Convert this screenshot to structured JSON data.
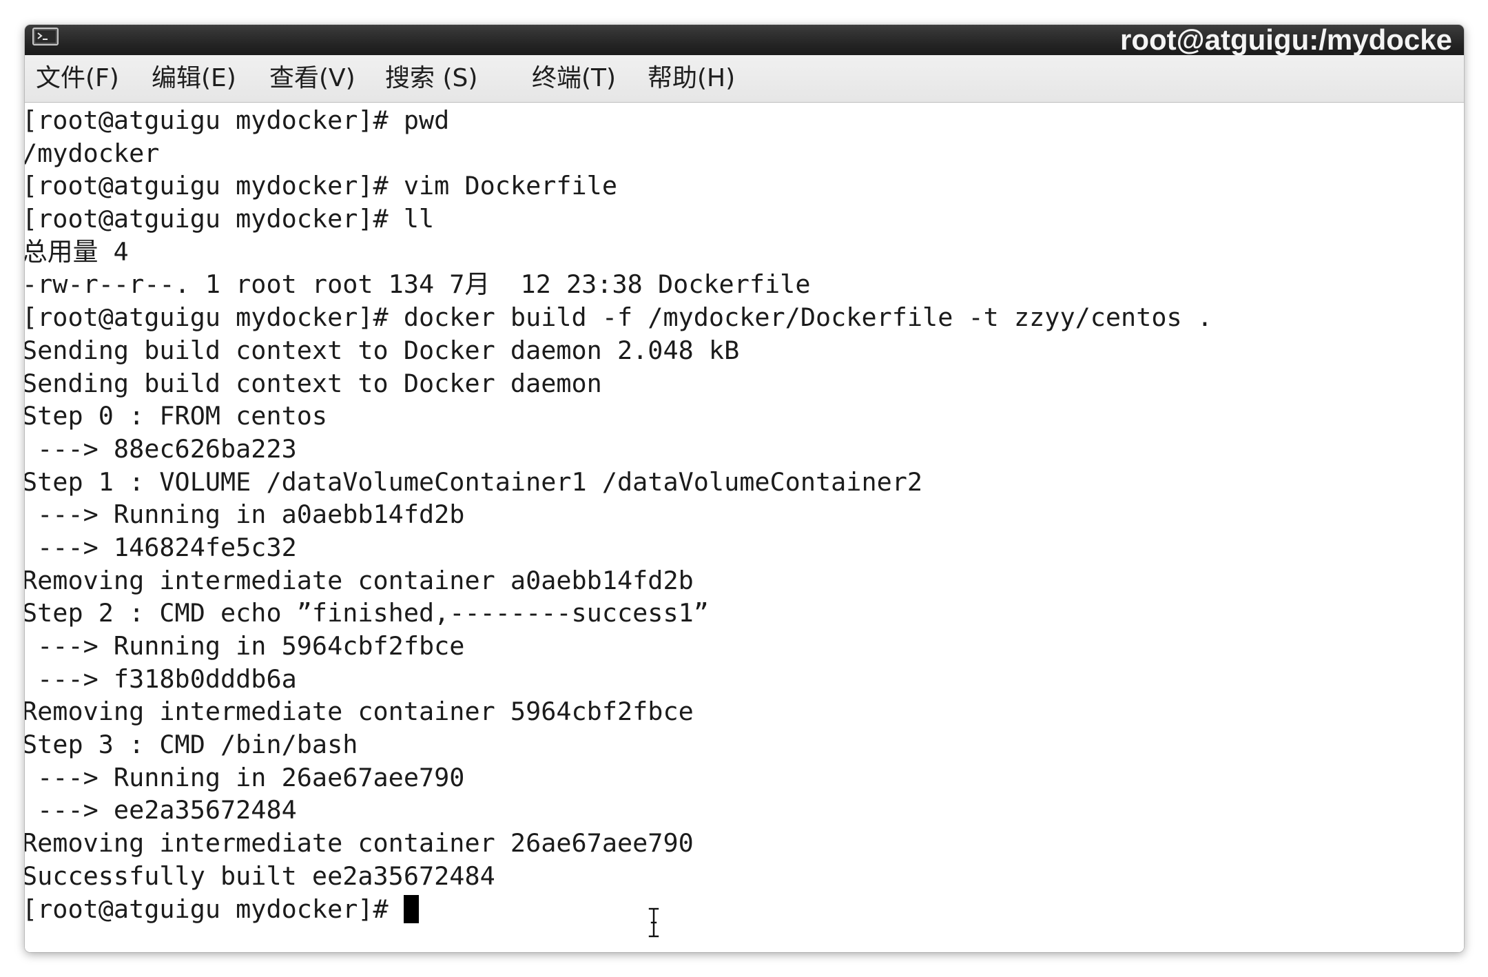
{
  "window": {
    "title": "root@atguigu:/mydocke",
    "titlebar_icon": "terminal-icon"
  },
  "menu": {
    "items": [
      {
        "label": "文件(F)"
      },
      {
        "label": "编辑(E)"
      },
      {
        "label": "查看(V)"
      },
      {
        "label": "搜索 (S)"
      },
      {
        "label": "终端(T)"
      },
      {
        "label": "帮助(H)"
      }
    ]
  },
  "terminal": {
    "lines": [
      "[root@atguigu mydocker]# pwd",
      "/mydocker",
      "[root@atguigu mydocker]# vim Dockerfile",
      "[root@atguigu mydocker]# ll",
      "总用量 4",
      "-rw-r--r--. 1 root root 134 7月  12 23:38 Dockerfile",
      "[root@atguigu mydocker]# docker build -f /mydocker/Dockerfile -t zzyy/centos .",
      "Sending build context to Docker daemon 2.048 kB",
      "Sending build context to Docker daemon",
      "Step 0 : FROM centos",
      " ---> 88ec626ba223",
      "Step 1 : VOLUME /dataVolumeContainer1 /dataVolumeContainer2",
      " ---> Running in a0aebb14fd2b",
      " ---> 146824fe5c32",
      "Removing intermediate container a0aebb14fd2b",
      "Step 2 : CMD echo ”finished,--------success1”",
      " ---> Running in 5964cbf2fbce",
      " ---> f318b0dddb6a",
      "Removing intermediate container 5964cbf2fbce",
      "Step 3 : CMD /bin/bash",
      " ---> Running in 26ae67aee790",
      " ---> ee2a35672484",
      "Removing intermediate container 26ae67aee790",
      "Successfully built ee2a35672484"
    ],
    "prompt": "[root@atguigu mydocker]# "
  },
  "pointer_icon": "text-cursor-icon",
  "colors": {
    "titlebar": "#262626",
    "menubar": "#e6e6e6",
    "term-bg": "#ffffff",
    "term-fg": "#1b1b1b",
    "cursor": "#000000"
  }
}
